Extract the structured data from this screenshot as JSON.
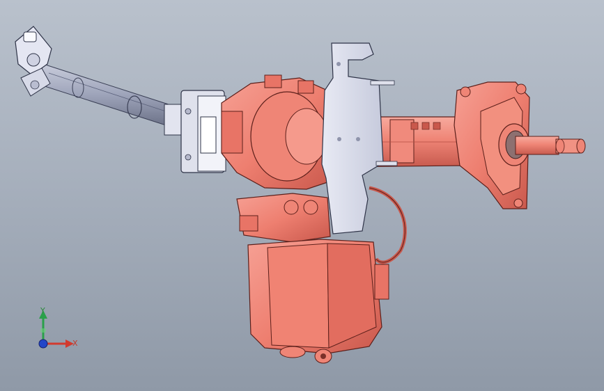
{
  "viewport": {
    "background_top": "#b9c1cc",
    "background_bottom": "#8f99a7",
    "model_primary_color": "#ee7f70",
    "model_shadow_color": "#c9584c",
    "model_secondary_color": "#d9dceb",
    "shaft_color": "#9ea4ba"
  },
  "triad": {
    "x_label": "X",
    "y_label": "Y",
    "x_color": "#d23a2e",
    "y_color": "#2aa04a",
    "z_color": "#2346c8"
  }
}
